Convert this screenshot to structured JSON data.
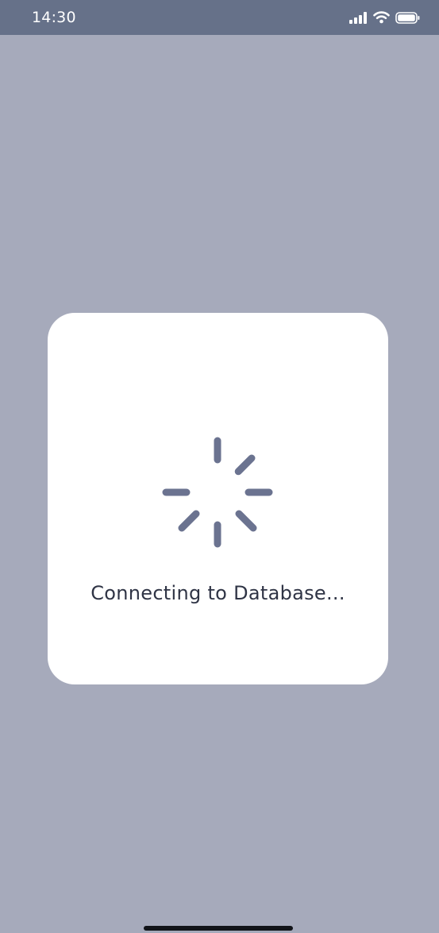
{
  "status_bar": {
    "time": "14:30",
    "icons": [
      "cellular-signal-icon",
      "wifi-icon",
      "battery-icon"
    ]
  },
  "dialog": {
    "message": "Connecting to Database..."
  },
  "colors": {
    "background": "#a6aabb",
    "status_bar": "#667189",
    "spinner": "#6b7390",
    "text": "#2f3445"
  }
}
